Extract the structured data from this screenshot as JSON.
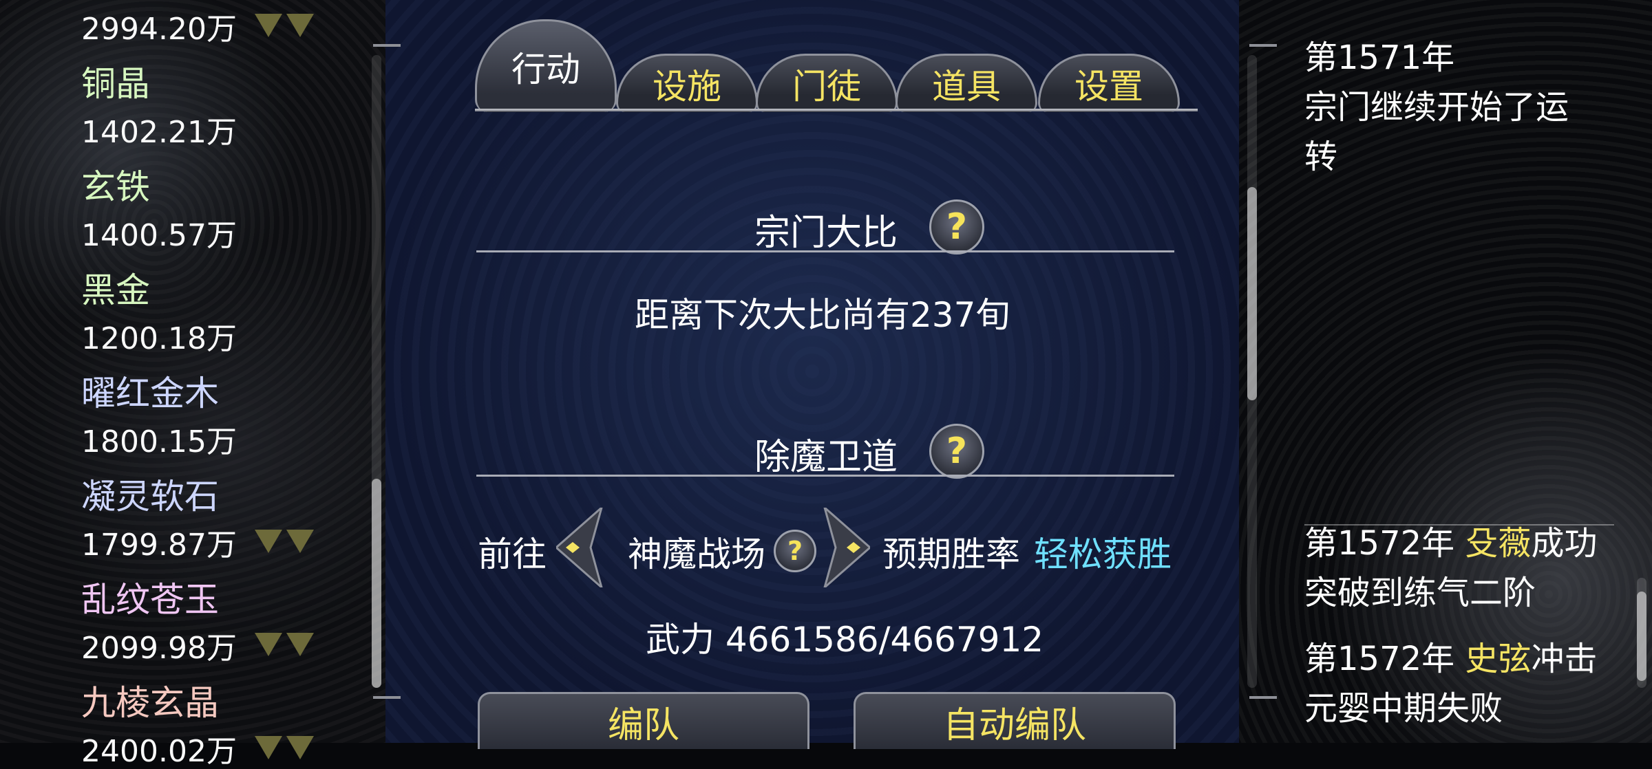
{
  "resources": [
    {
      "name": "",
      "amount": "2994.20万",
      "name_color": "#d7f7c0",
      "arrows": 2
    },
    {
      "name": "铜晶",
      "amount": "1402.21万",
      "name_color": "#d7f7c0",
      "arrows": 0
    },
    {
      "name": "玄铁",
      "amount": "1400.57万",
      "name_color": "#d7f7c0",
      "arrows": 0
    },
    {
      "name": "黑金",
      "amount": "1200.18万",
      "name_color": "#d7f7c0",
      "arrows": 0
    },
    {
      "name": "曜红金木",
      "amount": "1800.15万",
      "name_color": "#cdd6ff",
      "arrows": 0
    },
    {
      "name": "凝灵软石",
      "amount": "1799.87万",
      "name_color": "#cdd6ff",
      "arrows": 2
    },
    {
      "name": "乱纹苍玉",
      "amount": "2099.98万",
      "name_color": "#f0c6f3",
      "arrows": 2
    },
    {
      "name": "九棱玄晶",
      "amount": "2400.02万",
      "name_color": "#f6c9c0",
      "arrows": 2
    }
  ],
  "tabs": [
    {
      "label": "行动",
      "active": true
    },
    {
      "label": "设施",
      "active": false
    },
    {
      "label": "门徒",
      "active": false
    },
    {
      "label": "道具",
      "active": false
    },
    {
      "label": "设置",
      "active": false
    }
  ],
  "tournament": {
    "title": "宗门大比",
    "countdown": "距离下次大比尚有237旬"
  },
  "demon": {
    "title": "除魔卫道",
    "go_label": "前往",
    "location": "神魔战场",
    "win_rate_label": "预期胜率",
    "win_rate_value": "轻松获胜",
    "power": "武力 4661586/4667912"
  },
  "buttons": {
    "team": "编队",
    "auto_team": "自动编队"
  },
  "log": {
    "entry1_line1": "第1571年",
    "entry1_line2": "宗门继续开始了运",
    "entry1_line3": "转",
    "entry2_prefix": "第1572年 ",
    "entry2_name": "殳薇",
    "entry2_suffix1": "成功",
    "entry2_line2": "突破到练气二阶",
    "entry3_prefix": "第1572年 ",
    "entry3_name": "史弦",
    "entry3_suffix1": "冲击",
    "entry3_line2": "元婴中期失败"
  },
  "colors": {
    "accent_yellow": "#f5e463",
    "win_rate": "#6fe0ff"
  }
}
